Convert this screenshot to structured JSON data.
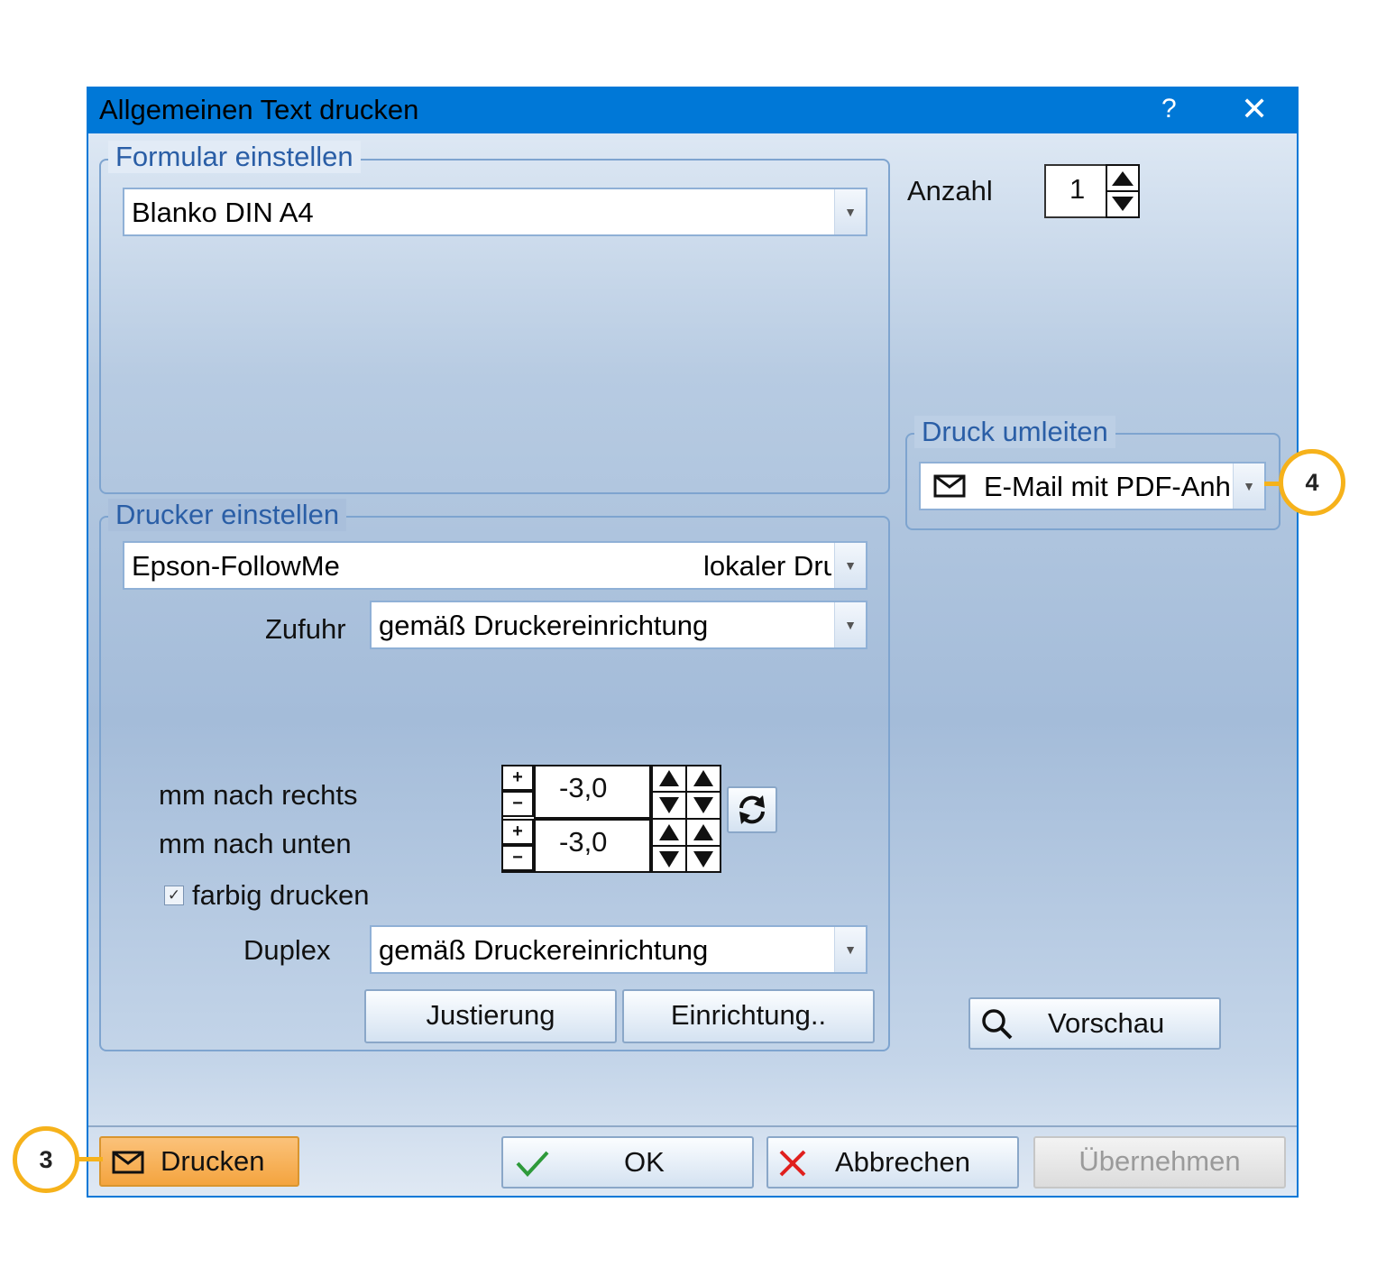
{
  "window": {
    "title": "Allgemeinen Text drucken",
    "help_label": "?",
    "close_label": "✕"
  },
  "formular": {
    "legend": "Formular einstellen",
    "value": "Blanko DIN A4"
  },
  "anzahl": {
    "label": "Anzahl",
    "value": "1"
  },
  "umleiten": {
    "legend": "Druck umleiten",
    "value": "E-Mail mit PDF-Anh"
  },
  "drucker": {
    "legend": "Drucker einstellen",
    "printer": "Epson-FollowMe",
    "printer_type": "lokaler Dru",
    "zufuhr_label": "Zufuhr",
    "zufuhr_value": "gemäß Druckereinrichtung",
    "rechts_label": "mm nach rechts",
    "rechts_value": "-3,0",
    "unten_label": "mm nach unten",
    "unten_value": "-3,0",
    "farbig_label": "farbig drucken",
    "farbig_checked": true,
    "duplex_label": "Duplex",
    "duplex_value": "gemäß Druckereinrichtung",
    "justierung_label": "Justierung",
    "einrichtung_label": "Einrichtung.."
  },
  "vorschau_label": "Vorschau",
  "footer": {
    "drucken_label": "Drucken",
    "ok_label": "OK",
    "abbrechen_label": "Abbrechen",
    "uebernehmen_label": "Übernehmen"
  },
  "callouts": {
    "left": "3",
    "right": "4"
  },
  "colors": {
    "titlebar": "#0078d7",
    "legend": "#2a5ea6",
    "highlight_button": "#f5a742",
    "callout_ring": "#f6b21b"
  }
}
